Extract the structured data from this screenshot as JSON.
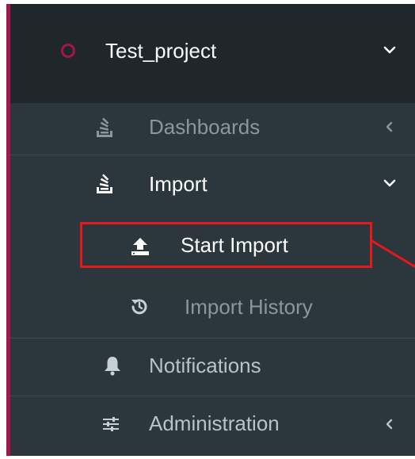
{
  "sidebar": {
    "project": {
      "label": "Test_project",
      "icon": "circle-outline-icon",
      "chevron": "chevron-down-icon",
      "accent_color": "#a3174d"
    },
    "items": [
      {
        "label": "Dashboards",
        "icon": "stack-icon",
        "chevron": "chevron-left-icon"
      },
      {
        "label": "Import",
        "icon": "stack-icon",
        "chevron": "chevron-down-icon"
      },
      {
        "label": "Start Import",
        "icon": "upload-icon",
        "highlighted": true,
        "highlight_color": "#e41919"
      },
      {
        "label": "Import History",
        "icon": "history-icon"
      },
      {
        "label": "Notifications",
        "icon": "bell-icon"
      },
      {
        "label": "Administration",
        "icon": "sliders-icon",
        "chevron": "chevron-left-icon"
      }
    ]
  }
}
